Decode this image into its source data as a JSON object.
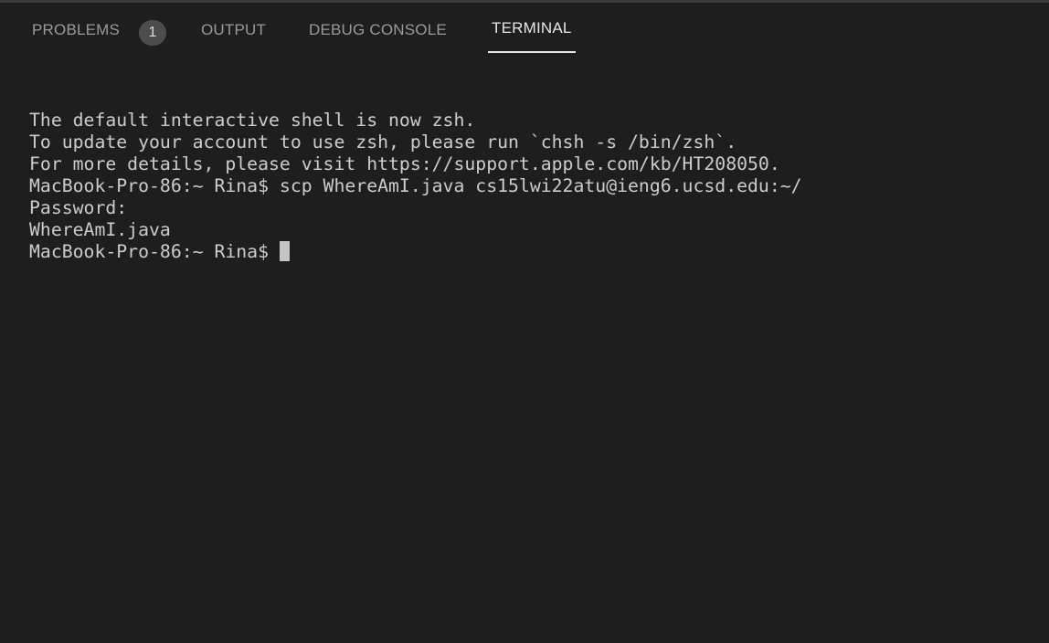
{
  "tabs": [
    {
      "label": "PROBLEMS",
      "badge": "1",
      "active": false
    },
    {
      "label": "OUTPUT",
      "active": false
    },
    {
      "label": "DEBUG CONSOLE",
      "active": false
    },
    {
      "label": "TERMINAL",
      "active": true
    }
  ],
  "terminal": {
    "lines": [
      "The default interactive shell is now zsh.",
      "To update your account to use zsh, please run `chsh -s /bin/zsh`.",
      "For more details, please visit https://support.apple.com/kb/HT208050.",
      "MacBook-Pro-86:~ Rina$ scp WhereAmI.java cs15lwi22atu@ieng6.ucsd.edu:~/",
      "Password:",
      "WhereAmI.java"
    ],
    "prompt": "MacBook-Pro-86:~ Rina$ "
  }
}
